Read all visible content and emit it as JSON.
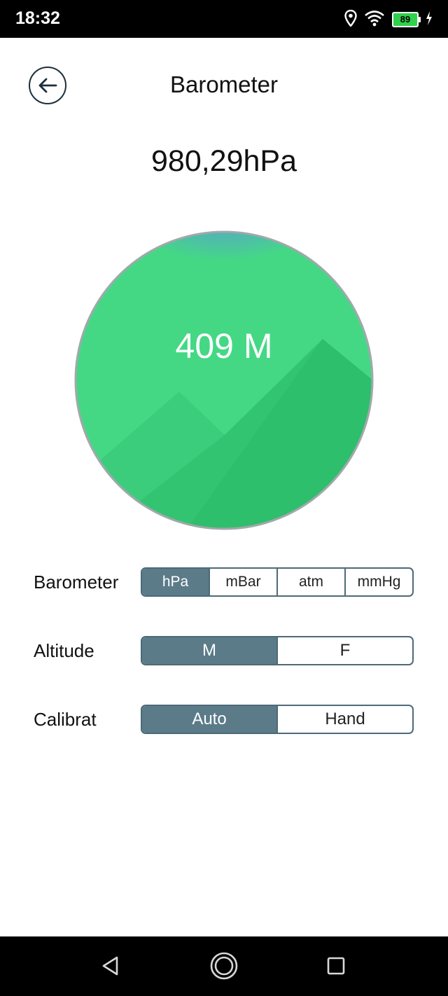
{
  "status_bar": {
    "time": "18:32",
    "battery": "89"
  },
  "header": {
    "title": "Barometer"
  },
  "pressure": {
    "value": "980,29hPa"
  },
  "gauge": {
    "altitude": "409 M"
  },
  "settings": {
    "barometer": {
      "label": "Barometer",
      "options": [
        "hPa",
        "mBar",
        "atm",
        "mmHg"
      ],
      "selected": "hPa"
    },
    "altitude": {
      "label": "Altitude",
      "options": [
        "M",
        "F"
      ],
      "selected": "M"
    },
    "calibrate": {
      "label": "Calibrat",
      "options": [
        "Auto",
        "Hand"
      ],
      "selected": "Auto"
    }
  },
  "colors": {
    "accent": "#5b7b89",
    "gauge_green": "#44d885",
    "gauge_blue": "#5b86e5"
  }
}
